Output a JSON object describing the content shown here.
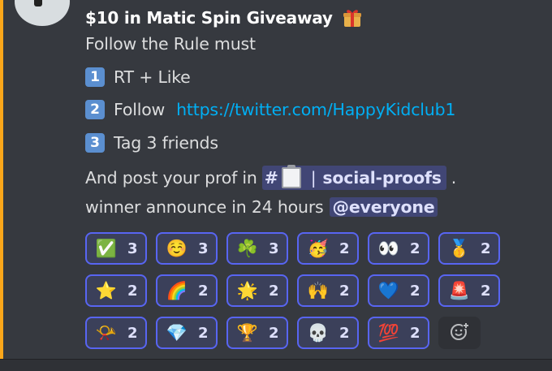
{
  "message": {
    "title": "$10 in Matic Spin Giveaway",
    "title_icon": "gift-icon",
    "intro": "Follow the Rule must",
    "rules": [
      {
        "number": "1",
        "text": "RT + Like"
      },
      {
        "number": "2",
        "text": "Follow",
        "link": "https://twitter.com/HappyKidclub1"
      },
      {
        "number": "3",
        "text": "Tag 3 friends"
      }
    ],
    "post_prefix": "And post your prof in",
    "channel": {
      "hash": "#",
      "icon": "clipboard-icon",
      "separator": "|",
      "name": "social-proofs"
    },
    "post_suffix": ".",
    "announce": "winner announce in 24 hours",
    "mention": "@everyone"
  },
  "reactions": [
    {
      "emoji": "✅",
      "icon": "check-mark-icon",
      "count": "3"
    },
    {
      "emoji": "☺️",
      "icon": "smiling-face-icon",
      "count": "3"
    },
    {
      "emoji": "☘️",
      "icon": "shamrock-icon",
      "count": "3"
    },
    {
      "emoji": "🥳",
      "icon": "party-face-icon",
      "count": "2"
    },
    {
      "emoji": "👀",
      "icon": "eyes-icon",
      "count": "2"
    },
    {
      "emoji": "🥇",
      "icon": "gold-medal-icon",
      "count": "2"
    },
    {
      "emoji": "⭐",
      "icon": "star-icon",
      "count": "2"
    },
    {
      "emoji": "🌈",
      "icon": "rainbow-icon",
      "count": "2"
    },
    {
      "emoji": "🌟",
      "icon": "glowing-star-icon",
      "count": "2"
    },
    {
      "emoji": "🙌",
      "icon": "raised-hands-icon",
      "count": "2"
    },
    {
      "emoji": "💙",
      "icon": "blue-heart-icon",
      "count": "2"
    },
    {
      "emoji": "🚨",
      "icon": "siren-icon",
      "count": "2"
    },
    {
      "emoji": "📯",
      "icon": "postal-horn-icon",
      "count": "2"
    },
    {
      "emoji": "💎",
      "icon": "gem-icon",
      "count": "2"
    },
    {
      "emoji": "🏆",
      "icon": "trophy-icon",
      "count": "2"
    },
    {
      "emoji": "💀",
      "icon": "skull-icon",
      "count": "2"
    },
    {
      "emoji": "💯",
      "icon": "hundred-points-icon",
      "count": "2"
    }
  ],
  "add_reaction_icon": "add-reaction-icon",
  "colors": {
    "accent": "#faa61a",
    "mention_bg": "#414675",
    "link": "#00aff4",
    "reaction_border": "#5865f2"
  }
}
